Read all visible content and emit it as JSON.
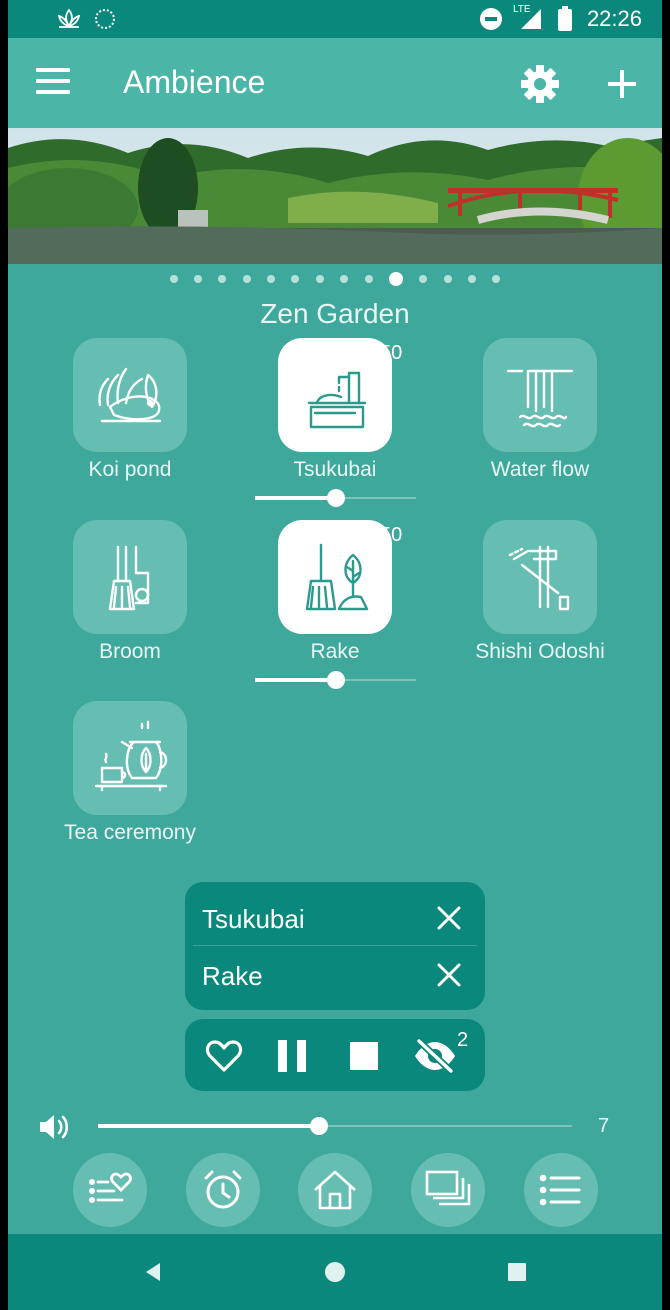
{
  "status_bar": {
    "time": "22:26",
    "network": "LTE"
  },
  "app_bar": {
    "title": "Ambience"
  },
  "carousel": {
    "page_count": 14,
    "active_index": 9
  },
  "scene": {
    "title": "Zen Garden",
    "sounds": [
      {
        "label": "Koi pond",
        "icon": "koi-pond-icon",
        "active": false
      },
      {
        "label": "Tsukubai",
        "icon": "tsukubai-icon",
        "active": true,
        "volume": "50",
        "level": 0.5
      },
      {
        "label": "Water flow",
        "icon": "water-flow-icon",
        "active": false
      },
      {
        "label": "Broom",
        "icon": "broom-icon",
        "active": false
      },
      {
        "label": "Rake",
        "icon": "rake-icon",
        "active": true,
        "volume": "50",
        "level": 0.5
      },
      {
        "label": "Shishi Odoshi",
        "icon": "shishi-odoshi-icon",
        "active": false
      },
      {
        "label": "Tea ceremony",
        "icon": "tea-ceremony-icon",
        "active": false
      }
    ]
  },
  "now_playing": {
    "items": [
      {
        "name": "Tsukubai"
      },
      {
        "name": "Rake"
      }
    ],
    "hidden_count": "2"
  },
  "master_volume": {
    "value": "7",
    "level": 0.466
  },
  "bottom_nav": [
    "favorites-list-icon",
    "alarm-clock-icon",
    "home-icon",
    "scenes-layers-icon",
    "list-icon"
  ],
  "colors": {
    "primary_dark": "#0b887c",
    "primary": "#4bb5a8",
    "background": "#3fa89c",
    "tile": "#66bdb2"
  }
}
